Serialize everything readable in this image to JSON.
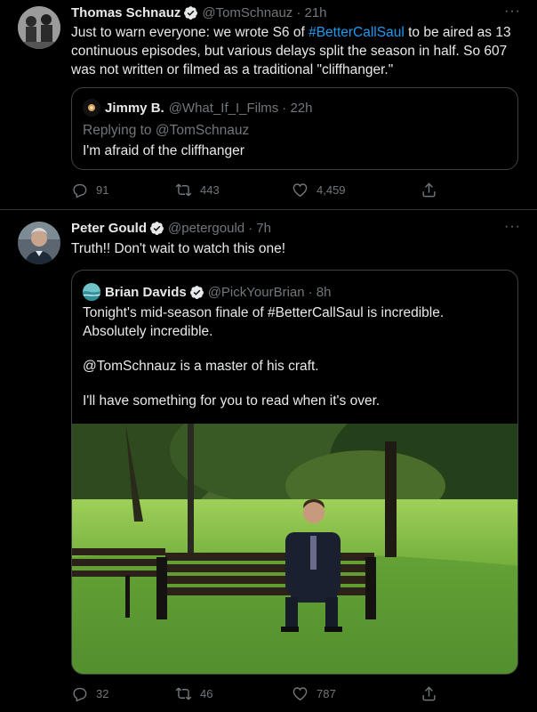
{
  "tweet1": {
    "author_name": "Thomas Schnauz",
    "handle": "@TomSchnauz",
    "time": "· 21h",
    "text_before": "Just to warn everyone: we wrote S6 of ",
    "hashtag": "#BetterCallSaul",
    "text_after": " to be aired as 13 continuous episodes, but various delays split the season in half. So 607 was not written or filmed as a traditional \"cliffhanger.\"",
    "more": "···",
    "quote": {
      "author_name": "Jimmy B.",
      "handle": "@What_If_I_Films",
      "time": "· 22h",
      "replying_to": "Replying to @TomSchnauz",
      "text": "I'm afraid of the cliffhanger"
    },
    "actions": {
      "replies": "91",
      "retweets": "443",
      "likes": "4,459"
    }
  },
  "tweet2": {
    "author_name": "Peter Gould",
    "handle": "@petergould",
    "time": "· 7h",
    "text": "Truth!!  Don't wait to watch this one!",
    "more": "···",
    "quote": {
      "author_name": "Brian Davids",
      "handle": "@PickYourBrian",
      "time": "· 8h",
      "line1": "Tonight's mid-season finale of #BetterCallSaul is incredible. Absolutely incredible.",
      "line2": "@TomSchnauz is a master of his craft.",
      "line3": "I'll have something for you to read when it's over."
    },
    "actions": {
      "replies": "32",
      "retweets": "46",
      "likes": "787"
    }
  },
  "colors": {
    "background": "#000000",
    "link": "#1d9bf0",
    "muted": "#71767b",
    "text": "#e7e9ea",
    "verified": "#1d9bf0"
  }
}
